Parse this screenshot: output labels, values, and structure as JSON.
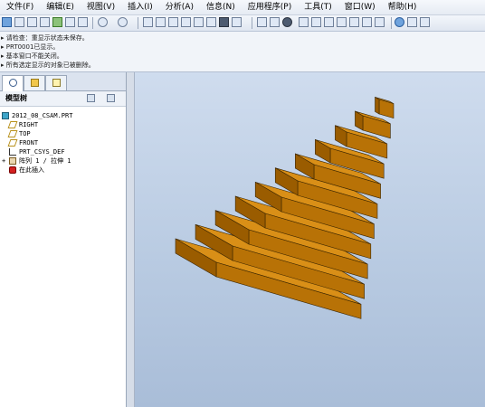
{
  "menubar": {
    "items": [
      "文件(F)",
      "编辑(E)",
      "视图(V)",
      "插入(I)",
      "分析(A)",
      "信息(N)",
      "应用程序(P)",
      "工具(T)",
      "窗口(W)",
      "帮助(H)"
    ]
  },
  "messages": [
    "▸ 请检查：重显示状态未保存。",
    "▸ PRT0001已显示。",
    "▸ 基本窗口不能关闭。",
    "▸ 所有选定显示的对象已被删除。"
  ],
  "model_tree": {
    "title": "模型树",
    "items": [
      {
        "label": "2012_08_CSAM.PRT",
        "icon": "part-icon"
      },
      {
        "label": "RIGHT",
        "icon": "datum-plane-icon"
      },
      {
        "label": "TOP",
        "icon": "datum-plane-icon"
      },
      {
        "label": "FRONT",
        "icon": "datum-plane-icon"
      },
      {
        "label": "PRT_CSYS_DEF",
        "icon": "csys-icon"
      },
      {
        "label": "阵列 1 / 拉伸 1",
        "icon": "pattern-icon"
      },
      {
        "label": "在此插入",
        "icon": "insert-here-icon"
      }
    ]
  },
  "viewport": {
    "model": "stepped-pyramid",
    "colors": {
      "top": "#d98f17",
      "front": "#b87206",
      "side": "#9a5c00",
      "edge": "#3a2500",
      "bg_top": "#cfdcee",
      "bg_bottom": "#a9bdd8"
    }
  }
}
